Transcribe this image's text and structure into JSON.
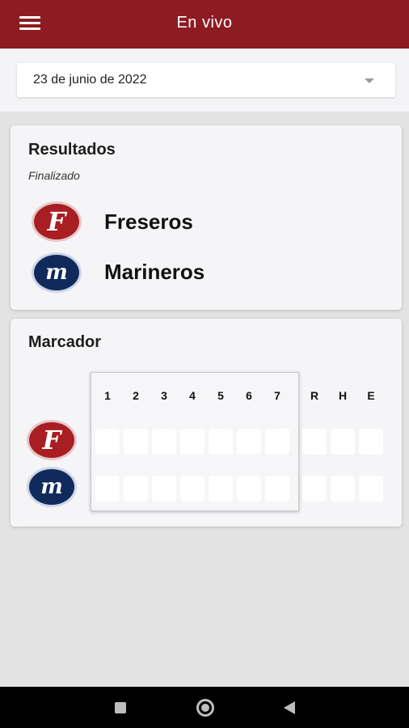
{
  "appbar": {
    "title": "En vivo",
    "menu_icon": "hamburger-menu-icon",
    "color": "#8e1b22"
  },
  "date_selector": {
    "value": "23 de junio de 2022",
    "icon": "chevron-down-icon"
  },
  "results": {
    "title": "Resultados",
    "status": "Finalizado",
    "teams": [
      {
        "name": "Freseros",
        "logo_letter": "F",
        "logo_color": "#a81e22"
      },
      {
        "name": "Marineros",
        "logo_letter": "m",
        "logo_color": "#102a5c"
      }
    ]
  },
  "scoreboard": {
    "title": "Marcador",
    "innings": [
      "1",
      "2",
      "3",
      "4",
      "5",
      "6",
      "7"
    ],
    "totals": [
      "R",
      "H",
      "E"
    ],
    "rows": [
      {
        "team_logo_letter": "F",
        "values": [
          "",
          "",
          "",
          "",
          "",
          "",
          "",
          "",
          "",
          ""
        ]
      },
      {
        "team_logo_letter": "m",
        "values": [
          "",
          "",
          "",
          "",
          "",
          "",
          "",
          "",
          "",
          ""
        ]
      }
    ]
  },
  "system_nav": {
    "icons": [
      "recent-apps-icon",
      "home-icon",
      "back-icon"
    ]
  }
}
